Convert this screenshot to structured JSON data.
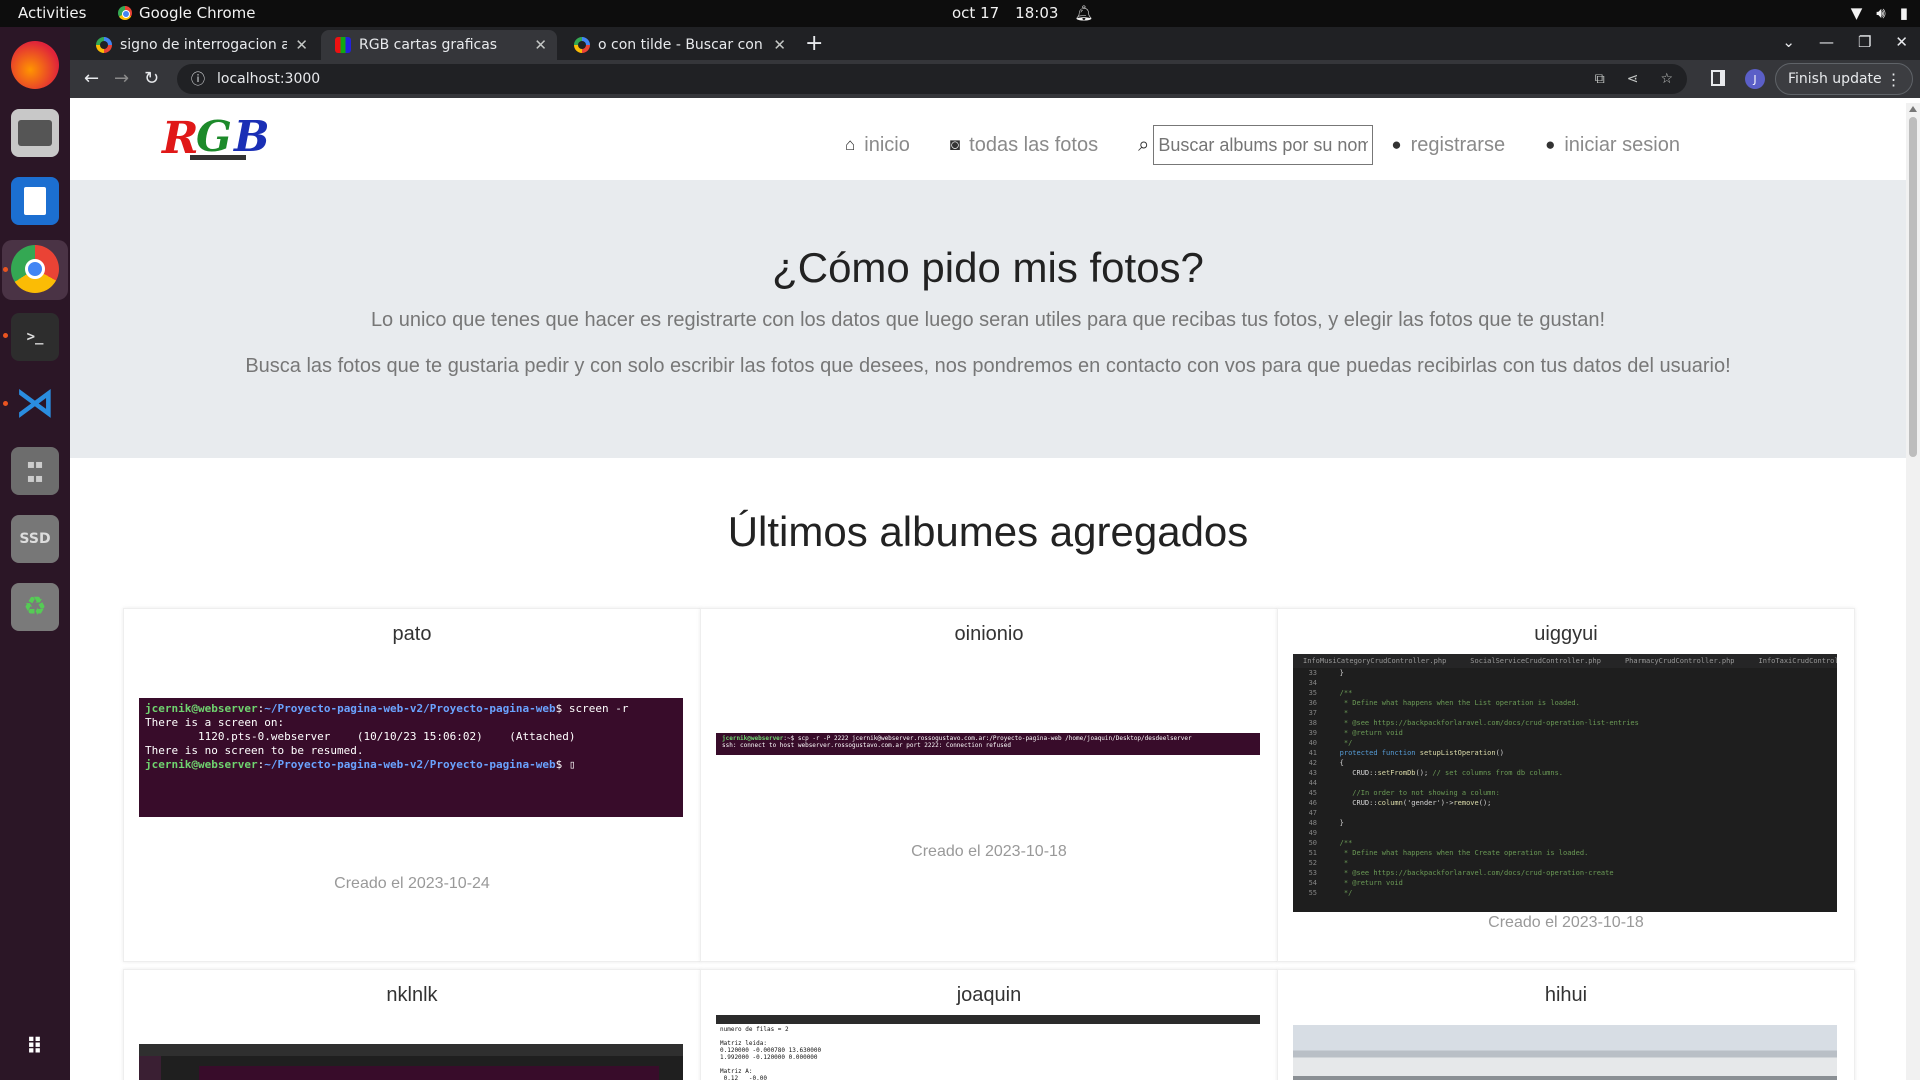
{
  "os": {
    "activities": "Activities",
    "app_name": "Google Chrome",
    "date": "oct 17",
    "time": "18:03"
  },
  "browser": {
    "tabs": [
      {
        "title": "signo de interrogacion ap"
      },
      {
        "title": "RGB cartas graficas"
      },
      {
        "title": "o con tilde - Buscar con Go"
      }
    ],
    "url": "localhost:3000",
    "profile_initial": "J",
    "finish_update": "Finish update"
  },
  "site": {
    "nav": {
      "inicio": "inicio",
      "todas": "todas las fotos",
      "search_placeholder": "Buscar albums por su nombre",
      "registrarse": "registrarse",
      "iniciar": "iniciar sesion"
    },
    "hero": {
      "title": "¿Cómo pido mis fotos?",
      "p1": "Lo unico que tenes que hacer es registrarte con los datos que luego seran utiles para que recibas tus fotos, y elegir las fotos que te gustan!",
      "p2": "Busca las fotos que te gustaria pedir y con solo escribir las fotos que desees, nos pondremos en contacto con vos para que puedas recibirlas con tus datos del usuario!"
    },
    "section_title": "Últimos albumes agregados",
    "albums": [
      {
        "name": "pato",
        "date": "Creado el 2023-10-24"
      },
      {
        "name": "oinionio",
        "date": "Creado el 2023-10-18"
      },
      {
        "name": "uiggyui",
        "date": "Creado el 2023-10-18"
      },
      {
        "name": "nklnlk"
      },
      {
        "name": "joaquin"
      },
      {
        "name": "hihui"
      }
    ]
  }
}
